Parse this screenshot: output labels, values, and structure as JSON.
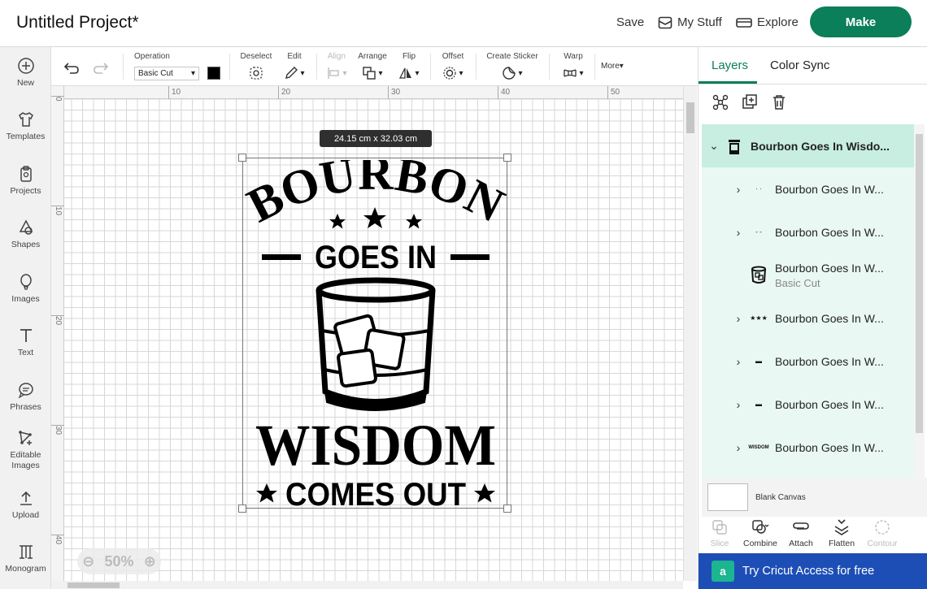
{
  "header": {
    "project_title": "Untitled Project*",
    "save_label": "Save",
    "my_stuff_label": "My Stuff",
    "explore_label": "Explore",
    "make_label": "Make",
    "brand_color": "#0b7e5a"
  },
  "sidebar": {
    "items": [
      {
        "label": "New",
        "icon": "plus-circle-icon"
      },
      {
        "label": "Templates",
        "icon": "shirt-icon"
      },
      {
        "label": "Projects",
        "icon": "clipboard-icon"
      },
      {
        "label": "Shapes",
        "icon": "shapes-icon"
      },
      {
        "label": "Images",
        "icon": "balloon-icon"
      },
      {
        "label": "Text",
        "icon": "text-icon"
      },
      {
        "label": "Phrases",
        "icon": "speech-bubble-icon"
      },
      {
        "label": "Editable Images",
        "icon": "edit-image-icon"
      },
      {
        "label": "Upload",
        "icon": "upload-icon"
      },
      {
        "label": "Monogram",
        "icon": "monogram-icon"
      }
    ]
  },
  "toolbar": {
    "operation_label": "Operation",
    "operation_value": "Basic Cut",
    "operation_color": "#000000",
    "deselect_label": "Deselect",
    "edit_label": "Edit",
    "align_label": "Align",
    "arrange_label": "Arrange",
    "flip_label": "Flip",
    "offset_label": "Offset",
    "create_sticker_label": "Create Sticker",
    "warp_label": "Warp",
    "more_label": "More"
  },
  "canvas": {
    "ruler_top": [
      "10",
      "20",
      "30",
      "40",
      "50"
    ],
    "ruler_left": [
      "0",
      "10",
      "20",
      "30",
      "40"
    ],
    "dimensions": "24.15  cm x 32.03  cm",
    "design_text": {
      "line1": "BOURBON",
      "line2": "GOES IN",
      "line3": "WISDOM",
      "line4": "COMES OUT"
    },
    "zoom": "50%"
  },
  "panel": {
    "tabs": [
      "Layers",
      "Color Sync"
    ],
    "group_name": "Bourbon Goes In Wisdo...",
    "layers": [
      {
        "name": "Bourbon Goes In W...",
        "thumb": "· ·",
        "expandable": true
      },
      {
        "name": "Bourbon Goes In W...",
        "thumb": "- -",
        "expandable": true
      },
      {
        "name": "Bourbon Goes In W...",
        "sub": "Basic Cut",
        "thumb": "glass",
        "expandable": false
      },
      {
        "name": "Bourbon Goes In W...",
        "thumb": "★★★",
        "expandable": true
      },
      {
        "name": "Bourbon Goes In W...",
        "thumb": "▬",
        "expandable": true
      },
      {
        "name": "Bourbon Goes In W...",
        "thumb": "▬",
        "expandable": true
      },
      {
        "name": "Bourbon Goes In W...",
        "thumb": "WISDOM",
        "expandable": true
      }
    ],
    "blank_canvas_label": "Blank Canvas",
    "actions": [
      {
        "label": "Slice",
        "enabled": false
      },
      {
        "label": "Combine",
        "enabled": true
      },
      {
        "label": "Attach",
        "enabled": true
      },
      {
        "label": "Flatten",
        "enabled": true
      },
      {
        "label": "Contour",
        "enabled": false
      }
    ],
    "promo_label": "Try Cricut Access for free"
  }
}
